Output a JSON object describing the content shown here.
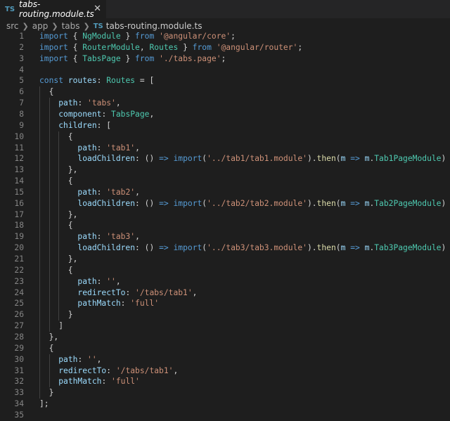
{
  "tab": {
    "badge": "TS",
    "title": "tabs-routing.module.ts",
    "close": "✕"
  },
  "breadcrumb": {
    "segments": [
      "src",
      "app",
      "tabs"
    ],
    "file_badge": "TS",
    "file": "tabs-routing.module.ts"
  },
  "editor": {
    "lines": [
      {
        "n": "1",
        "tokens": [
          [
            "k",
            "import"
          ],
          [
            "p",
            " { "
          ],
          [
            "t",
            "NgModule"
          ],
          [
            "p",
            " } "
          ],
          [
            "k",
            "from"
          ],
          [
            "p",
            " "
          ],
          [
            "s",
            "'@angular/core'"
          ],
          [
            "p",
            ";"
          ]
        ]
      },
      {
        "n": "2",
        "tokens": [
          [
            "k",
            "import"
          ],
          [
            "p",
            " { "
          ],
          [
            "t",
            "RouterModule"
          ],
          [
            "p",
            ", "
          ],
          [
            "t",
            "Routes"
          ],
          [
            "p",
            " } "
          ],
          [
            "k",
            "from"
          ],
          [
            "p",
            " "
          ],
          [
            "s",
            "'@angular/router'"
          ],
          [
            "p",
            ";"
          ]
        ]
      },
      {
        "n": "3",
        "tokens": [
          [
            "k",
            "import"
          ],
          [
            "p",
            " { "
          ],
          [
            "t",
            "TabsPage"
          ],
          [
            "p",
            " } "
          ],
          [
            "k",
            "from"
          ],
          [
            "p",
            " "
          ],
          [
            "s",
            "'./tabs.page'"
          ],
          [
            "p",
            ";"
          ]
        ]
      },
      {
        "n": "4",
        "tokens": []
      },
      {
        "n": "5",
        "tokens": [
          [
            "k",
            "const"
          ],
          [
            "p",
            " "
          ],
          [
            "v",
            "routes"
          ],
          [
            "p",
            ": "
          ],
          [
            "t",
            "Routes"
          ],
          [
            "p",
            " = ["
          ]
        ]
      },
      {
        "n": "6",
        "tokens": [
          [
            "p",
            "  {"
          ]
        ]
      },
      {
        "n": "7",
        "tokens": [
          [
            "p",
            "    "
          ],
          [
            "v",
            "path"
          ],
          [
            "p",
            ": "
          ],
          [
            "s",
            "'tabs'"
          ],
          [
            "p",
            ","
          ]
        ]
      },
      {
        "n": "8",
        "tokens": [
          [
            "p",
            "    "
          ],
          [
            "v",
            "component"
          ],
          [
            "p",
            ": "
          ],
          [
            "t",
            "TabsPage"
          ],
          [
            "p",
            ","
          ]
        ]
      },
      {
        "n": "9",
        "tokens": [
          [
            "p",
            "    "
          ],
          [
            "v",
            "children"
          ],
          [
            "p",
            ": ["
          ]
        ]
      },
      {
        "n": "10",
        "tokens": [
          [
            "p",
            "      {"
          ]
        ]
      },
      {
        "n": "11",
        "tokens": [
          [
            "p",
            "        "
          ],
          [
            "v",
            "path"
          ],
          [
            "p",
            ": "
          ],
          [
            "s",
            "'tab1'"
          ],
          [
            "p",
            ","
          ]
        ]
      },
      {
        "n": "12",
        "tokens": [
          [
            "p",
            "        "
          ],
          [
            "v",
            "loadChildren"
          ],
          [
            "p",
            ": () "
          ],
          [
            "k",
            "=>"
          ],
          [
            "p",
            " "
          ],
          [
            "k",
            "import"
          ],
          [
            "p",
            "("
          ],
          [
            "s",
            "'../tab1/tab1.module'"
          ],
          [
            "p",
            ")."
          ],
          [
            "f",
            "then"
          ],
          [
            "p",
            "("
          ],
          [
            "v",
            "m"
          ],
          [
            "p",
            " "
          ],
          [
            "k",
            "=>"
          ],
          [
            "p",
            " "
          ],
          [
            "v",
            "m"
          ],
          [
            "p",
            "."
          ],
          [
            "t",
            "Tab1PageModule"
          ],
          [
            "p",
            ")"
          ]
        ]
      },
      {
        "n": "13",
        "tokens": [
          [
            "p",
            "      },"
          ]
        ]
      },
      {
        "n": "14",
        "tokens": [
          [
            "p",
            "      {"
          ]
        ]
      },
      {
        "n": "15",
        "tokens": [
          [
            "p",
            "        "
          ],
          [
            "v",
            "path"
          ],
          [
            "p",
            ": "
          ],
          [
            "s",
            "'tab2'"
          ],
          [
            "p",
            ","
          ]
        ]
      },
      {
        "n": "16",
        "tokens": [
          [
            "p",
            "        "
          ],
          [
            "v",
            "loadChildren"
          ],
          [
            "p",
            ": () "
          ],
          [
            "k",
            "=>"
          ],
          [
            "p",
            " "
          ],
          [
            "k",
            "import"
          ],
          [
            "p",
            "("
          ],
          [
            "s",
            "'../tab2/tab2.module'"
          ],
          [
            "p",
            ")."
          ],
          [
            "f",
            "then"
          ],
          [
            "p",
            "("
          ],
          [
            "v",
            "m"
          ],
          [
            "p",
            " "
          ],
          [
            "k",
            "=>"
          ],
          [
            "p",
            " "
          ],
          [
            "v",
            "m"
          ],
          [
            "p",
            "."
          ],
          [
            "t",
            "Tab2PageModule"
          ],
          [
            "p",
            ")"
          ]
        ]
      },
      {
        "n": "17",
        "tokens": [
          [
            "p",
            "      },"
          ]
        ]
      },
      {
        "n": "18",
        "tokens": [
          [
            "p",
            "      {"
          ]
        ]
      },
      {
        "n": "19",
        "tokens": [
          [
            "p",
            "        "
          ],
          [
            "v",
            "path"
          ],
          [
            "p",
            ": "
          ],
          [
            "s",
            "'tab3'"
          ],
          [
            "p",
            ","
          ]
        ]
      },
      {
        "n": "20",
        "tokens": [
          [
            "p",
            "        "
          ],
          [
            "v",
            "loadChildren"
          ],
          [
            "p",
            ": () "
          ],
          [
            "k",
            "=>"
          ],
          [
            "p",
            " "
          ],
          [
            "k",
            "import"
          ],
          [
            "p",
            "("
          ],
          [
            "s",
            "'../tab3/tab3.module'"
          ],
          [
            "p",
            ")."
          ],
          [
            "f",
            "then"
          ],
          [
            "p",
            "("
          ],
          [
            "v",
            "m"
          ],
          [
            "p",
            " "
          ],
          [
            "k",
            "=>"
          ],
          [
            "p",
            " "
          ],
          [
            "v",
            "m"
          ],
          [
            "p",
            "."
          ],
          [
            "t",
            "Tab3PageModule"
          ],
          [
            "p",
            ")"
          ]
        ]
      },
      {
        "n": "21",
        "tokens": [
          [
            "p",
            "      },"
          ]
        ]
      },
      {
        "n": "22",
        "tokens": [
          [
            "p",
            "      {"
          ]
        ]
      },
      {
        "n": "23",
        "tokens": [
          [
            "p",
            "        "
          ],
          [
            "v",
            "path"
          ],
          [
            "p",
            ": "
          ],
          [
            "s",
            "''"
          ],
          [
            "p",
            ","
          ]
        ]
      },
      {
        "n": "24",
        "tokens": [
          [
            "p",
            "        "
          ],
          [
            "v",
            "redirectTo"
          ],
          [
            "p",
            ": "
          ],
          [
            "s",
            "'/tabs/tab1'"
          ],
          [
            "p",
            ","
          ]
        ]
      },
      {
        "n": "25",
        "tokens": [
          [
            "p",
            "        "
          ],
          [
            "v",
            "pathMatch"
          ],
          [
            "p",
            ": "
          ],
          [
            "s",
            "'full'"
          ]
        ]
      },
      {
        "n": "26",
        "tokens": [
          [
            "p",
            "      }"
          ]
        ]
      },
      {
        "n": "27",
        "tokens": [
          [
            "p",
            "    ]"
          ]
        ]
      },
      {
        "n": "28",
        "tokens": [
          [
            "p",
            "  },"
          ]
        ]
      },
      {
        "n": "29",
        "tokens": [
          [
            "p",
            "  {"
          ]
        ]
      },
      {
        "n": "30",
        "tokens": [
          [
            "p",
            "    "
          ],
          [
            "v",
            "path"
          ],
          [
            "p",
            ": "
          ],
          [
            "s",
            "''"
          ],
          [
            "p",
            ","
          ]
        ]
      },
      {
        "n": "31",
        "tokens": [
          [
            "p",
            "    "
          ],
          [
            "v",
            "redirectTo"
          ],
          [
            "p",
            ": "
          ],
          [
            "s",
            "'/tabs/tab1'"
          ],
          [
            "p",
            ","
          ]
        ]
      },
      {
        "n": "32",
        "tokens": [
          [
            "p",
            "    "
          ],
          [
            "v",
            "pathMatch"
          ],
          [
            "p",
            ": "
          ],
          [
            "s",
            "'full'"
          ]
        ]
      },
      {
        "n": "33",
        "tokens": [
          [
            "p",
            "  }"
          ]
        ]
      },
      {
        "n": "34",
        "tokens": [
          [
            "p",
            "];"
          ]
        ]
      },
      {
        "n": "35",
        "tokens": []
      }
    ]
  }
}
